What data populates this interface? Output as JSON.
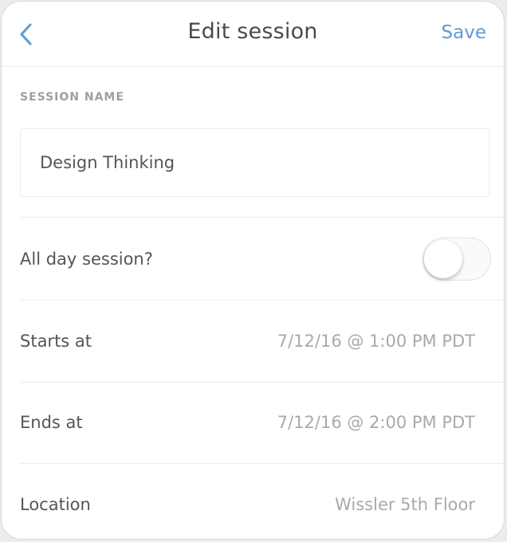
{
  "header": {
    "title": "Edit session",
    "save_label": "Save",
    "accent_color": "#5b9bd5"
  },
  "session_name": {
    "label": "SESSION NAME",
    "value": "Design Thinking"
  },
  "all_day": {
    "label": "All day session?",
    "enabled": false
  },
  "starts": {
    "label": "Starts at",
    "value": "7/12/16 @ 1:00 PM PDT"
  },
  "ends": {
    "label": "Ends at",
    "value": "7/12/16 @ 2:00 PM PDT"
  },
  "location": {
    "label": "Location",
    "value": "Wissler 5th Floor"
  },
  "icons": {
    "back": "chevron-left-icon"
  }
}
